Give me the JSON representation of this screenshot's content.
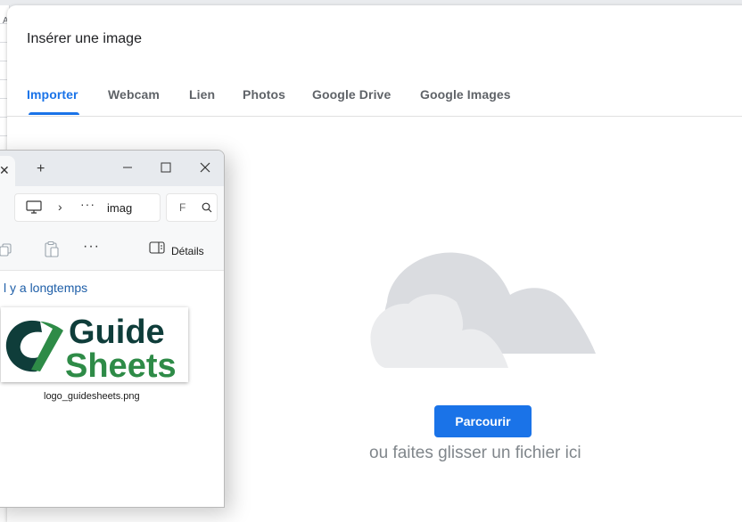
{
  "background": {
    "column_letter": "A"
  },
  "dialog": {
    "title": "Insérer une image",
    "tabs": [
      {
        "label": "Importer",
        "active": true
      },
      {
        "label": "Webcam",
        "active": false
      },
      {
        "label": "Lien",
        "active": false
      },
      {
        "label": "Photos",
        "active": false
      },
      {
        "label": "Google Drive",
        "active": false
      },
      {
        "label": "Google Images",
        "active": false
      }
    ],
    "upload": {
      "browse_label": "Parcourir",
      "drop_hint": "ou faites glisser un fichier ici"
    }
  },
  "explorer": {
    "tab_close": "✕",
    "new_tab": "+",
    "address": {
      "chevron": "›",
      "more": "···",
      "path": "imag"
    },
    "search_placeholder": "F",
    "toolbar": {
      "more": "···",
      "details_label": "Détails"
    },
    "group_header": "l y a longtemps",
    "file": {
      "name": "logo_guidesheets.png",
      "logo_text_top": "Guide",
      "logo_text_bottom": "Sheets"
    }
  },
  "colors": {
    "accent": "#1a73e8",
    "logo_dark": "#0f3d3a",
    "logo_green": "#2e8b47"
  }
}
